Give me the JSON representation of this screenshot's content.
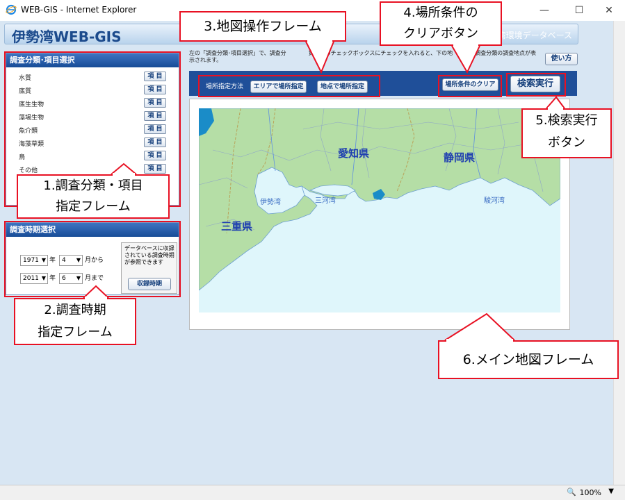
{
  "window": {
    "title": "WEB-GIS - Internet Explorer",
    "controls": {
      "minimize": "—",
      "maximize": "☐",
      "close": "✕"
    }
  },
  "site": {
    "title": "伊勢湾WEB-GIS",
    "subtitle": "湾環境データベース"
  },
  "category_panel": {
    "header": "調査分類･項目選択",
    "button_label": "項 目",
    "items": [
      "水質",
      "底質",
      "底生生物",
      "藻場生物",
      "魚介類",
      "海藻草類",
      "鳥",
      "その他"
    ]
  },
  "period_panel": {
    "header": "調査時期選択",
    "from_year": "1971",
    "from_month": "4",
    "to_year": "2011",
    "to_month": "6",
    "year_unit": "年",
    "from_suffix": "月から",
    "to_suffix": "月まで",
    "note": "データベースに収録されている調査時期が参照できます",
    "record_button": "収録時期"
  },
  "instructions": "左の「調査分類･項目選択」で、調査分　　　　賃等）のチェックボックスにチェックを入れると、下の地　　　　調査分類の調査地点が表示されます。",
  "howto_button": "使い方",
  "map_toolbar": {
    "label": "場所指定方法",
    "area_button": "エリアで場所指定",
    "point_button": "地点で場所指定",
    "clear_button": "場所条件のクリア",
    "search_button": "検索実行"
  },
  "map": {
    "prefectures": [
      "愛知県",
      "静岡県",
      "三重県"
    ],
    "bays": [
      "伊勢湾",
      "三河湾",
      "駿河湾"
    ]
  },
  "callouts": {
    "c1": [
      "1.調査分類・項目",
      "指定フレーム"
    ],
    "c2": [
      "2.調査時期",
      "指定フレーム"
    ],
    "c3": [
      "3.地図操作フレーム"
    ],
    "c4": [
      "4.場所条件の",
      "クリアボタン"
    ],
    "c5": [
      "5.検索実行",
      "ボタン"
    ],
    "c6": [
      "6.メイン地図フレーム"
    ]
  },
  "status": {
    "zoom": "100%"
  },
  "colors": {
    "accent": "#1f4f99",
    "callout": "#e81123",
    "sea": "#dff6fb",
    "land": "#b5dea6"
  }
}
